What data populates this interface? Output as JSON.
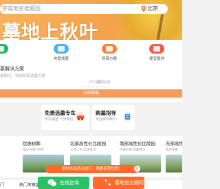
{
  "search": {
    "placeholder": "字或地名搜墓园"
  },
  "location": {
    "city": "北京"
  },
  "hero": {
    "title": "墓地上秋叶"
  },
  "quick_nav": [
    {
      "label": "",
      "icon": "list-icon",
      "color": "#2db36d"
    },
    {
      "label": "地图找墓",
      "icon": "map-icon",
      "color": "#4fb3ea"
    },
    {
      "label": "殡葬方案",
      "icon": "document-icon",
      "color": "#f4843b"
    },
    {
      "label": "便宜墓地",
      "icon": "tag-icon",
      "color": "#ef5b4f"
    }
  ],
  "plan": {
    "title": "墓解决方案",
    "subtitle": "墓顾问，快速获取选墓方案",
    "budget_placeholder": "2万以下",
    "area_placeholder": "墓园区域",
    "submit_label": "立即获取"
  },
  "cards": [
    {
      "title": "免费选墓专车",
      "subtitle": "专车接送 一步到位",
      "icon": "car-icon"
    },
    {
      "title": "购墓指导",
      "subtitle": "专业顾问带行",
      "icon": "guide-icon"
    }
  ],
  "cemeteries": [
    {
      "name": "优质树葬",
      "desc": "生态 绿色 环保"
    },
    {
      "name": "北部高性价比陵园",
      "desc": "上风上水 高速直达"
    },
    {
      "name": "南部高性价比陵园",
      "desc": "优质价格 高速直达"
    },
    {
      "name": "东部高性",
      "desc": "适合东部"
    }
  ],
  "bottom_labels": {
    "left": "门",
    "middle": "热门考察墓园"
  },
  "promo": {
    "text": "墓地乐选活动进行，购墓享受优惠！",
    "close": "×"
  },
  "actions": {
    "chat": "在线咨询",
    "call": "墓地官方顾问"
  }
}
